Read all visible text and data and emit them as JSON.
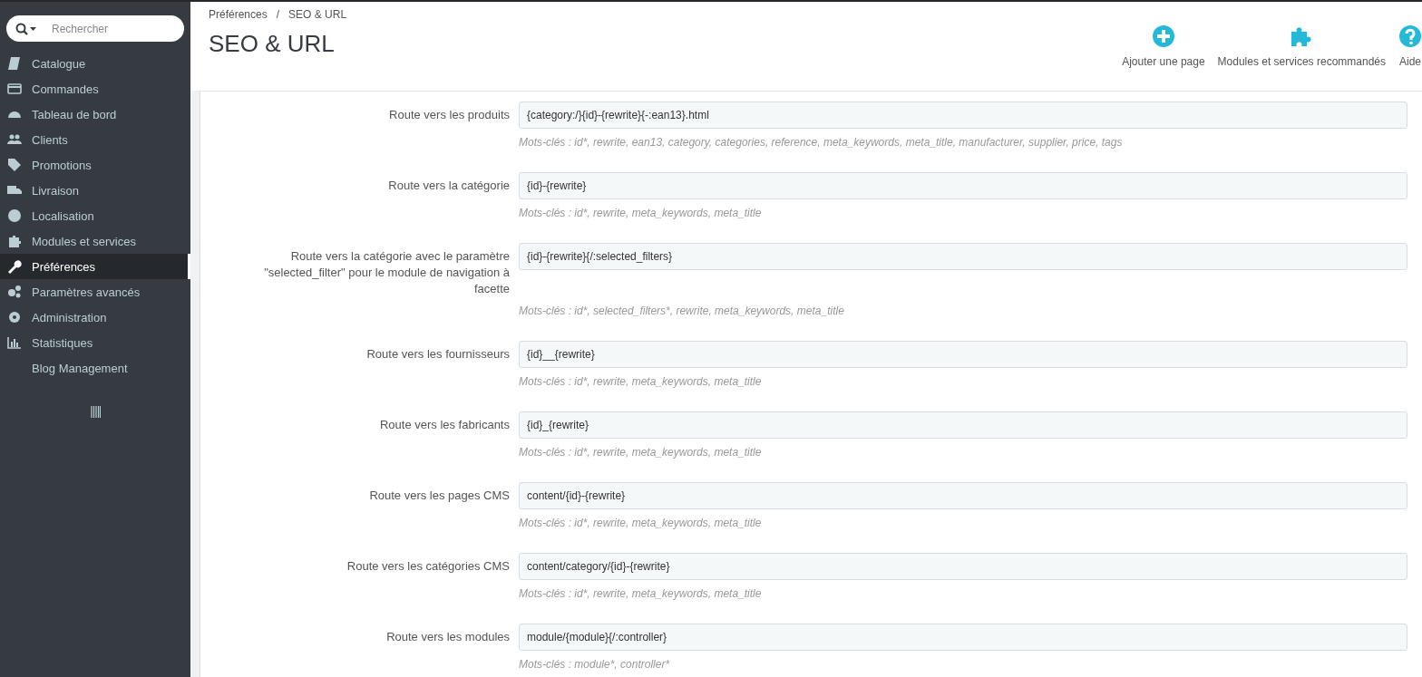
{
  "sidebar": {
    "search": {
      "placeholder": "Rechercher"
    },
    "items": [
      {
        "label": "Catalogue",
        "selected": false
      },
      {
        "label": "Commandes",
        "selected": false
      },
      {
        "label": "Tableau de bord",
        "selected": false
      },
      {
        "label": "Clients",
        "selected": false
      },
      {
        "label": "Promotions",
        "selected": false
      },
      {
        "label": "Livraison",
        "selected": false
      },
      {
        "label": "Localisation",
        "selected": false
      },
      {
        "label": "Modules et services",
        "selected": false
      },
      {
        "label": "Préférences",
        "selected": true
      },
      {
        "label": "Paramètres avancés",
        "selected": false
      },
      {
        "label": "Administration",
        "selected": false
      },
      {
        "label": "Statistiques",
        "selected": false
      },
      {
        "label": "Blog Management",
        "selected": false
      }
    ]
  },
  "header": {
    "breadcrumb": [
      "Préférences",
      "SEO & URL"
    ],
    "breadcrumb_separator": "/",
    "title": "SEO & URL",
    "toolbar": [
      {
        "label": "Ajouter une page",
        "kind": "add"
      },
      {
        "label": "Modules et services recommandés",
        "kind": "modules"
      },
      {
        "label": "Aide",
        "kind": "help"
      }
    ]
  },
  "routes": [
    {
      "label": "Route vers les produits",
      "value": "{category:/}{id}-{rewrite}{-:ean13}.html",
      "hint": "Mots-clés : id*, rewrite, ean13, category, categories, reference, meta_keywords, meta_title, manufacturer, supplier, price, tags"
    },
    {
      "label": "Route vers la catégorie",
      "value": "{id}-{rewrite}",
      "hint": "Mots-clés : id*, rewrite, meta_keywords, meta_title"
    },
    {
      "label": "Route vers la catégorie avec le paramètre \"selected_filter\" pour le module de navigation à facette",
      "value": "{id}-{rewrite}{/:selected_filters}",
      "hint": "Mots-clés : id*, selected_filters*, rewrite, meta_keywords, meta_title"
    },
    {
      "label": "Route vers les fournisseurs",
      "value": "{id}__{rewrite}",
      "hint": "Mots-clés : id*, rewrite, meta_keywords, meta_title"
    },
    {
      "label": "Route vers les fabricants",
      "value": "{id}_{rewrite}",
      "hint": "Mots-clés : id*, rewrite, meta_keywords, meta_title"
    },
    {
      "label": "Route vers les pages CMS",
      "value": "content/{id}-{rewrite}",
      "hint": "Mots-clés : id*, rewrite, meta_keywords, meta_title"
    },
    {
      "label": "Route vers les catégories CMS",
      "value": "content/category/{id}-{rewrite}",
      "hint": "Mots-clés : id*, rewrite, meta_keywords, meta_title"
    },
    {
      "label": "Route vers les modules",
      "value": "module/{module}{/:controller}",
      "hint": "Mots-clés : module*, controller*"
    }
  ]
}
